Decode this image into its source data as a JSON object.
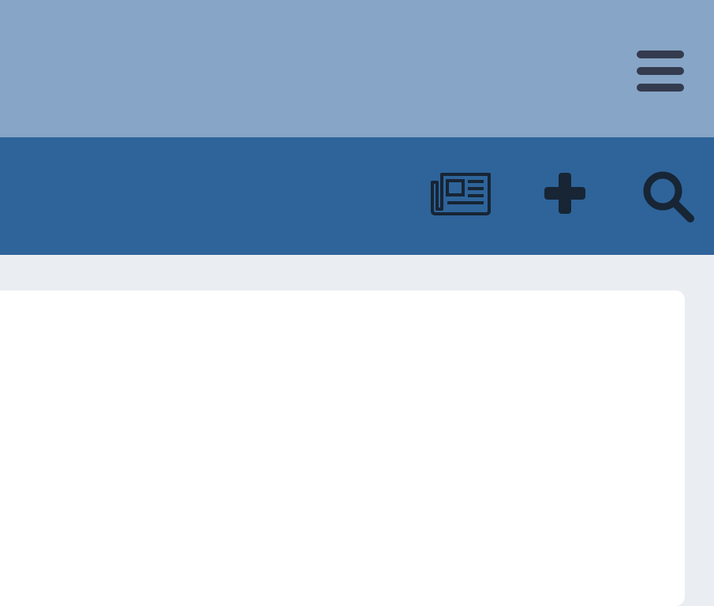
{
  "icons": {
    "menu": "hamburger-menu-icon",
    "news": "newspaper-icon",
    "add": "plus-icon",
    "search": "search-icon"
  },
  "colors": {
    "top_bar": "#87a5c6",
    "nav_bar": "#2e649a",
    "background": "#eaedf2",
    "card": "#ffffff",
    "icon_dark": "#343b4f",
    "icon_nav": "#172535"
  }
}
